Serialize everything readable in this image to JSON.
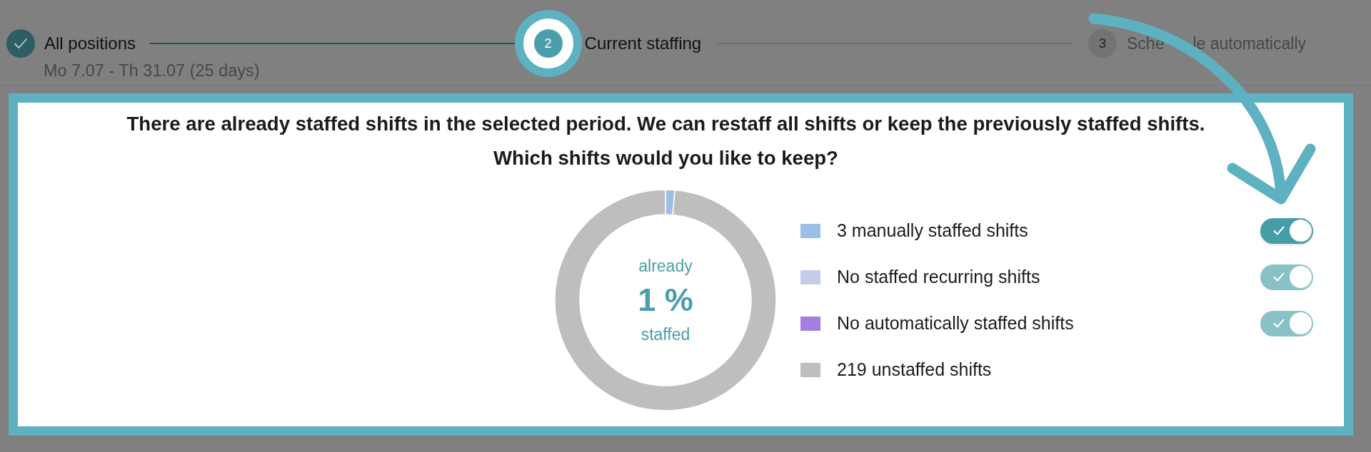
{
  "stepper": {
    "steps": [
      {
        "completed": true,
        "selected": false,
        "highlighted": false,
        "label_parts": [
          "All positions"
        ],
        "subtitle": "Mo 7.07 - Th 31.07 (25 days)"
      },
      {
        "completed": false,
        "selected": true,
        "highlighted": true,
        "number": "2",
        "label_parts": [
          "Current staffing"
        ]
      },
      {
        "completed": false,
        "selected": false,
        "highlighted": false,
        "number": "3",
        "label_parts": [
          "Sche",
          "le automatically"
        ]
      }
    ]
  },
  "card": {
    "prompt_lines": [
      "There are already staffed shifts in the selected period. We can restaff all shifts or keep the previously staffed shifts.",
      "Which shifts would you like to keep?"
    ],
    "chart_data": {
      "type": "donut",
      "values": [
        1.35,
        0,
        0,
        98.65
      ]
    },
    "chart_center": {
      "caption_top": "already",
      "value": "1 %",
      "caption_bottom": "staffed"
    },
    "legend": [
      {
        "label": "3 manually staffed shifts",
        "color": "#9bbfe6",
        "toggle": {
          "checked": true,
          "disabled": false
        }
      },
      {
        "label": "No staffed recurring shifts",
        "color": "#c3cde9",
        "toggle": {
          "checked": true,
          "disabled": true
        }
      },
      {
        "label": "No automatically staffed shifts",
        "color": "#a47fe0",
        "toggle": {
          "checked": true,
          "disabled": true
        }
      },
      {
        "label": "219 unstaffed shifts",
        "color": "#bebebe"
      }
    ]
  }
}
